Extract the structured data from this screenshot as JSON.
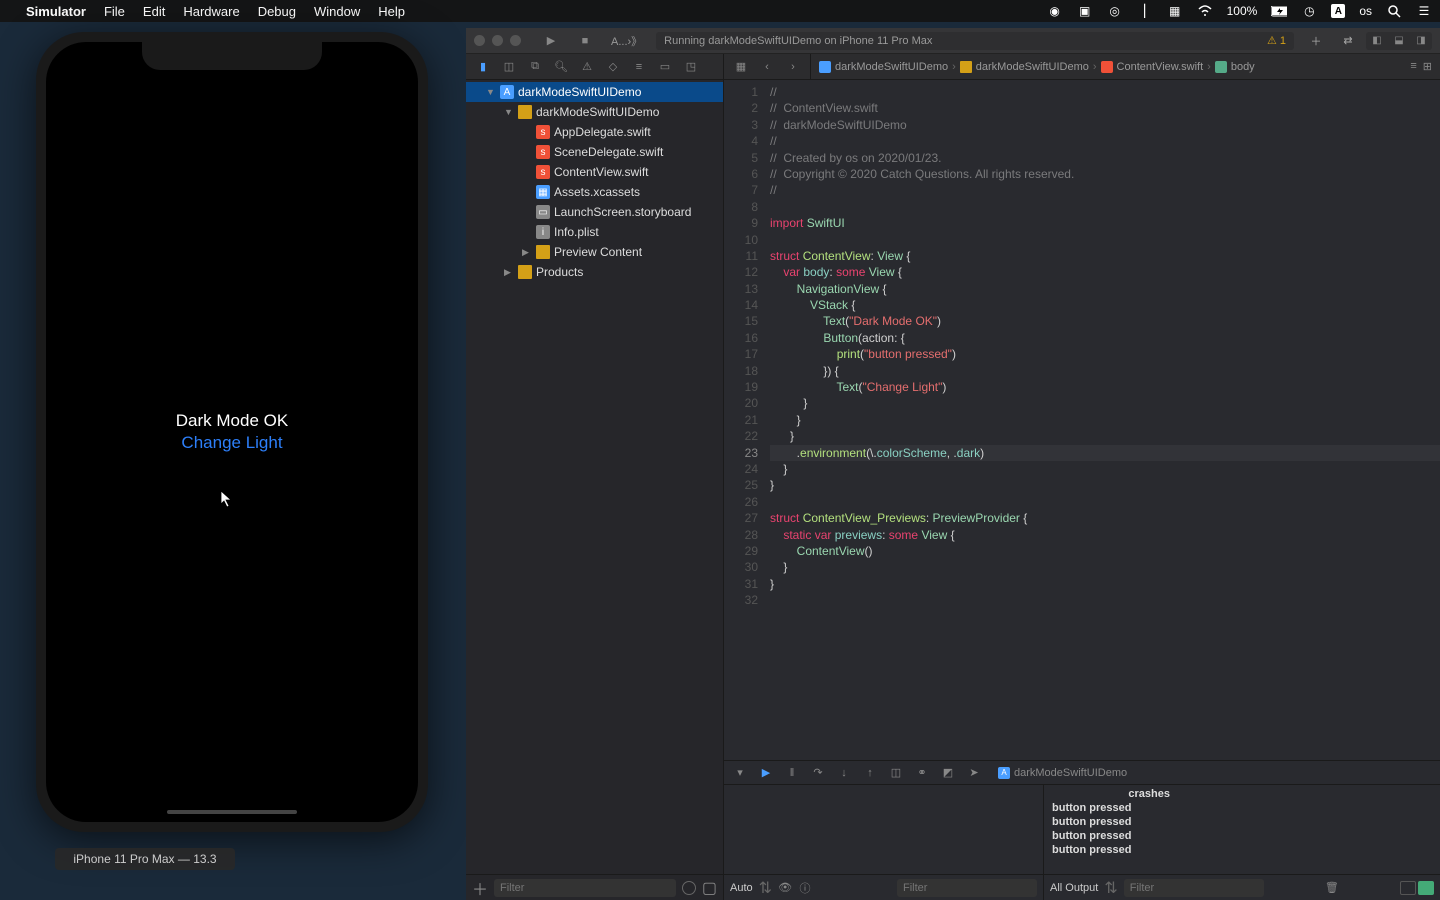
{
  "menubar": {
    "app": "Simulator",
    "items": [
      "File",
      "Edit",
      "Hardware",
      "Debug",
      "Window",
      "Help"
    ],
    "battery": "100%",
    "user": "os"
  },
  "simulator": {
    "text": "Dark Mode OK",
    "button": "Change Light",
    "label": "iPhone 11 Pro Max — 13.3"
  },
  "xcode": {
    "status": "Running darkModeSwiftUIDemo on iPhone 11 Pro Max",
    "warnings": "1",
    "scheme": "A...›》",
    "breadcrumb": [
      "darkModeSwiftUIDemo",
      "darkModeSwiftUIDemo",
      "ContentView.swift",
      "body"
    ],
    "nav": {
      "root": "darkModeSwiftUIDemo",
      "group": "darkModeSwiftUIDemo",
      "files": [
        "AppDelegate.swift",
        "SceneDelegate.swift",
        "ContentView.swift",
        "Assets.xcassets",
        "LaunchScreen.storyboard",
        "Info.plist"
      ],
      "preview": "Preview Content",
      "products": "Products",
      "filter_placeholder": "Filter"
    },
    "code": {
      "lines": [
        {
          "n": 1,
          "t": "comment",
          "s": "//"
        },
        {
          "n": 2,
          "t": "comment",
          "s": "//  ContentView.swift"
        },
        {
          "n": 3,
          "t": "comment",
          "s": "//  darkModeSwiftUIDemo"
        },
        {
          "n": 4,
          "t": "comment",
          "s": "//"
        },
        {
          "n": 5,
          "t": "comment",
          "s": "//  Created by os on 2020/01/23."
        },
        {
          "n": 6,
          "t": "comment",
          "s": "//  Copyright © 2020 Catch Questions. All rights reserved."
        },
        {
          "n": 7,
          "t": "comment",
          "s": "//"
        },
        {
          "n": 8,
          "t": "blank",
          "s": ""
        },
        {
          "n": 9,
          "t": "import",
          "kw": "import",
          "id": "SwiftUI"
        },
        {
          "n": 10,
          "t": "blank",
          "s": ""
        },
        {
          "n": 11,
          "t": "struct1"
        },
        {
          "n": 12,
          "t": "var_body"
        },
        {
          "n": 13,
          "t": "nav"
        },
        {
          "n": 14,
          "t": "vstack"
        },
        {
          "n": 15,
          "t": "text1",
          "str": "\"Dark Mode OK\""
        },
        {
          "n": 16,
          "t": "button_open"
        },
        {
          "n": 17,
          "t": "print",
          "str": "\"button pressed\""
        },
        {
          "n": 18,
          "t": "button_mid"
        },
        {
          "n": 19,
          "t": "text2",
          "str": "\"Change Light\""
        },
        {
          "n": 20,
          "t": "close",
          "indent": 10
        },
        {
          "n": 21,
          "t": "close",
          "indent": 8
        },
        {
          "n": 22,
          "t": "close",
          "indent": 6
        },
        {
          "n": 23,
          "t": "env",
          "hl": true
        },
        {
          "n": 24,
          "t": "close",
          "indent": 4
        },
        {
          "n": 25,
          "t": "close",
          "indent": 0
        },
        {
          "n": 26,
          "t": "blank",
          "s": ""
        },
        {
          "n": 27,
          "t": "struct2"
        },
        {
          "n": 28,
          "t": "static_prev"
        },
        {
          "n": 29,
          "t": "cv_call"
        },
        {
          "n": 30,
          "t": "close",
          "indent": 4
        },
        {
          "n": 31,
          "t": "close",
          "indent": 0
        },
        {
          "n": 32,
          "t": "blank",
          "s": ""
        }
      ]
    },
    "debug": {
      "target": "darkModeSwiftUIDemo",
      "console": [
        "                         crashes",
        "button pressed",
        "button pressed",
        "button pressed",
        "button pressed"
      ],
      "auto": "Auto",
      "all_output": "All Output",
      "filter_placeholder": "Filter"
    }
  }
}
